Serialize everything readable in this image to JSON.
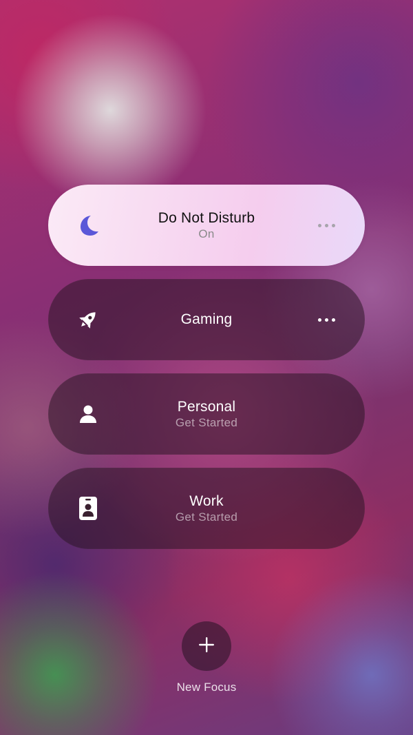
{
  "focus_modes": [
    {
      "title": "Do Not Disturb",
      "subtitle": "On",
      "icon": "moon-icon",
      "active": true,
      "icon_color": "#5b57d8"
    },
    {
      "title": "Gaming",
      "subtitle": "",
      "icon": "rocket-icon",
      "active": false
    },
    {
      "title": "Personal",
      "subtitle": "Get Started",
      "icon": "person-icon",
      "active": false
    },
    {
      "title": "Work",
      "subtitle": "Get Started",
      "icon": "id-badge-icon",
      "active": false
    }
  ],
  "new_focus": {
    "label": "New Focus",
    "icon": "plus-icon"
  }
}
